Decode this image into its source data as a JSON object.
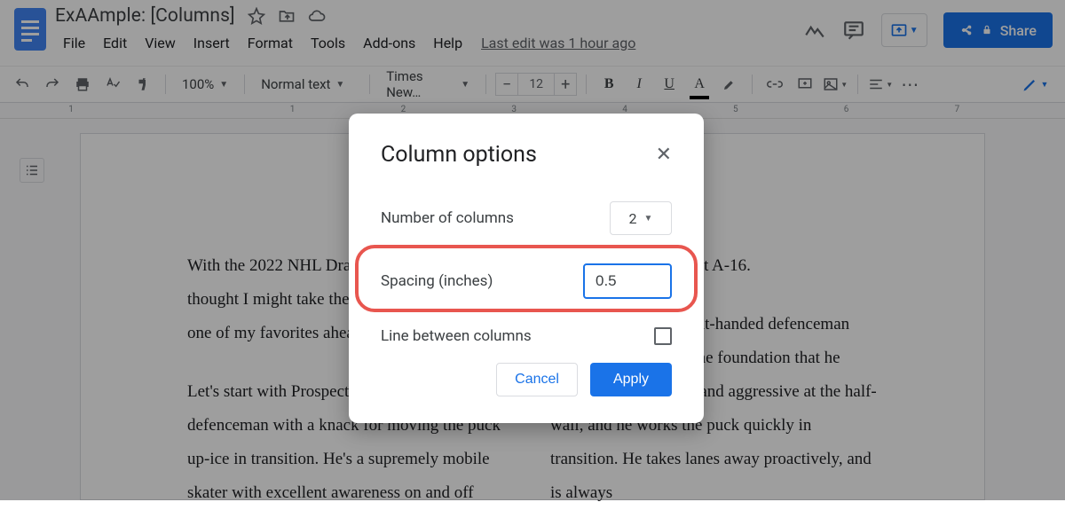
{
  "header": {
    "title": "ExAAmple: [Columns]",
    "menus": [
      "File",
      "Edit",
      "View",
      "Insert",
      "Format",
      "Tools",
      "Add-ons",
      "Help"
    ],
    "last_edit": "Last edit was 1 hour ago",
    "share_label": "Share"
  },
  "toolbar": {
    "zoom": "100%",
    "style": "Normal text",
    "font": "Times New…",
    "font_size": "12"
  },
  "ruler": {
    "labels": [
      "1",
      "1",
      "2",
      "3",
      "4",
      "5",
      "6",
      "7"
    ]
  },
  "document": {
    "col1_p1": "With the 2022 NHL Draft a few months away, I thought I might take the time to shine a light on one of my favorites ahead of the summer.",
    "col1_p2": "Let's start with Prospect A-4, a left-handed defenceman with a knack for moving the puck up-ice in transition. He's a supremely mobile skater with excellent awareness on and off",
    "col2_p1": "Let me turn to Prospect A-16.",
    "col2_p2": "Prospect A-16 is a right-handed defenceman who can thrive upon the foundation that he builds. He is physical and aggressive at the half-wall, and he works the puck quickly in transition. He takes lanes away proactively, and is always"
  },
  "dialog": {
    "title": "Column options",
    "num_cols_label": "Number of columns",
    "num_cols_value": "2",
    "spacing_label": "Spacing (inches)",
    "spacing_value": "0.5",
    "line_between_label": "Line between columns",
    "cancel": "Cancel",
    "apply": "Apply"
  }
}
